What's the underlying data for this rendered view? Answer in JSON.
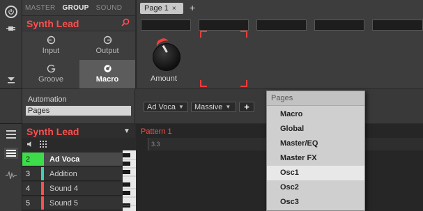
{
  "header": {
    "tabs": [
      "MASTER",
      "GROUP",
      "SOUND"
    ],
    "active_tab": "GROUP",
    "group_name": "Synth Lead"
  },
  "panel_buttons": [
    {
      "label": "Input",
      "icon": "input-icon"
    },
    {
      "label": "Output",
      "icon": "output-icon"
    },
    {
      "label": "Groove",
      "icon": "groove-icon"
    },
    {
      "label": "Macro",
      "icon": "macro-icon",
      "selected": true
    }
  ],
  "page_tab": {
    "label": "Page 1",
    "close": "×",
    "add": "+"
  },
  "knob": {
    "label": "Amount"
  },
  "automation": {
    "title": "Automation",
    "field_value": "Pages"
  },
  "plugin_selectors": [
    {
      "label": "Ad Voca"
    },
    {
      "label": "Massive"
    }
  ],
  "plugin_add": "+",
  "pattern_panel": {
    "group_name": "Synth Lead",
    "pattern_label": "Pattern 1",
    "ruler_label": "3.3"
  },
  "sounds": [
    {
      "num": "2",
      "name": "Ad Voca",
      "color": "#3ddc4a",
      "selected": true
    },
    {
      "num": "3",
      "name": "Addition",
      "color": "#3fd0b0"
    },
    {
      "num": "4",
      "name": "Sound 4",
      "color": "#ff4e4e"
    },
    {
      "num": "5",
      "name": "Sound 5",
      "color": "#ff4e4e"
    }
  ],
  "pages_menu": {
    "title": "Pages",
    "items": [
      "Macro",
      "Global",
      "Master/EQ",
      "Master FX",
      "Osc1",
      "Osc2",
      "Osc3"
    ],
    "highlighted": "Osc1"
  },
  "colors": {
    "accent": "#ff4e4e",
    "background": "#2b2b2b"
  }
}
